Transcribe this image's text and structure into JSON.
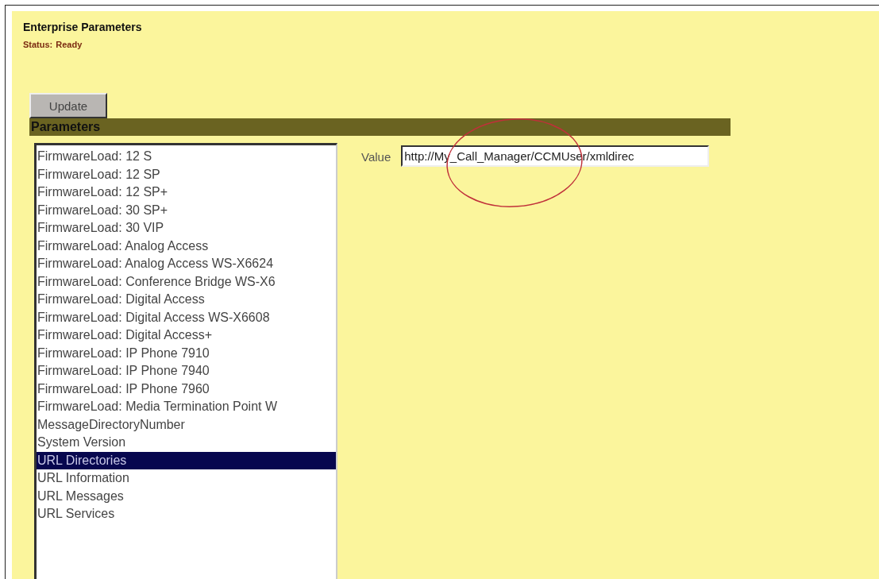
{
  "page": {
    "title": "Enterprise Parameters",
    "status_label": "Status:",
    "status": "Ready"
  },
  "update_button": "Update",
  "section": {
    "title": "Parameters"
  },
  "parameters": [
    {
      "label": "FirmwareLoad: 12 S",
      "selected": false
    },
    {
      "label": "FirmwareLoad: 12 SP",
      "selected": false
    },
    {
      "label": "FirmwareLoad: 12 SP+",
      "selected": false
    },
    {
      "label": "FirmwareLoad: 30 SP+",
      "selected": false
    },
    {
      "label": "FirmwareLoad: 30 VIP",
      "selected": false
    },
    {
      "label": "FirmwareLoad: Analog Access",
      "selected": false
    },
    {
      "label": "FirmwareLoad: Analog Access WS-X6624",
      "selected": false
    },
    {
      "label": "FirmwareLoad: Conference Bridge WS-X6",
      "selected": false
    },
    {
      "label": "FirmwareLoad: Digital Access",
      "selected": false
    },
    {
      "label": "FirmwareLoad: Digital Access WS-X6608",
      "selected": false
    },
    {
      "label": "FirmwareLoad: Digital Access+",
      "selected": false
    },
    {
      "label": "FirmwareLoad: IP Phone 7910",
      "selected": false
    },
    {
      "label": "FirmwareLoad: IP Phone 7940",
      "selected": false
    },
    {
      "label": "FirmwareLoad: IP Phone 7960",
      "selected": false
    },
    {
      "label": "FirmwareLoad: Media Termination Point W",
      "selected": false
    },
    {
      "label": "MessageDirectoryNumber",
      "selected": false
    },
    {
      "label": "System Version",
      "selected": false
    },
    {
      "label": "URL Directories",
      "selected": true
    },
    {
      "label": "URL Information",
      "selected": false
    },
    {
      "label": "URL Messages",
      "selected": false
    },
    {
      "label": "URL Services",
      "selected": false
    }
  ],
  "value_field": {
    "label": "Value",
    "value": "http://My_Call_Manager/CCMUser/xmldirec"
  }
}
